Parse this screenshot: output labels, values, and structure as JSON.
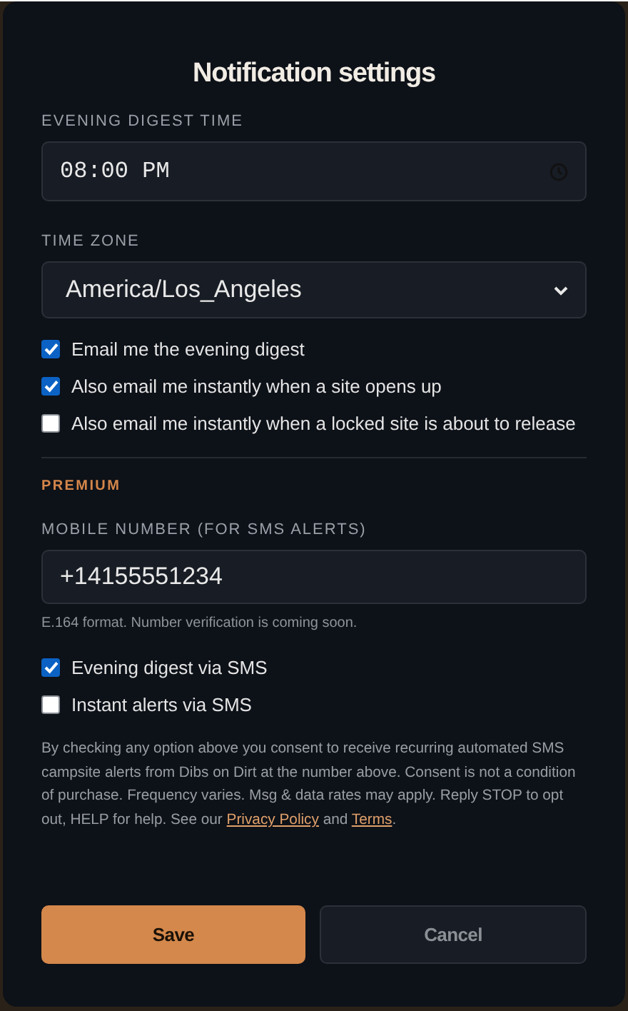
{
  "dialog": {
    "title": "Notification settings"
  },
  "time_field": {
    "label": "EVENING DIGEST TIME",
    "value": "08:00 PM"
  },
  "timezone_field": {
    "label": "TIME ZONE",
    "value": "America/Los_Angeles"
  },
  "email_options": [
    {
      "label": "Email me the evening digest",
      "checked": true
    },
    {
      "label": "Also email me instantly when a site opens up",
      "checked": true
    },
    {
      "label": "Also email me instantly when a locked site is about to release",
      "checked": false
    }
  ],
  "premium": {
    "heading": "PREMIUM",
    "phone_label": "MOBILE NUMBER (FOR SMS ALERTS)",
    "phone_value": "+14155551234",
    "helper": "E.164 format. Number verification is coming soon.",
    "sms_options": [
      {
        "label": "Evening digest via SMS",
        "checked": true
      },
      {
        "label": "Instant alerts via SMS",
        "checked": false
      }
    ],
    "consent": {
      "text": "By checking any option above you consent to receive recurring automated SMS campsite alerts from Dibs on Dirt at the number above. Consent is not a condition of purchase. Frequency varies. Msg & data rates may apply. Reply STOP to opt out, HELP for help. See our ",
      "links": [
        "Privacy Policy",
        "Terms"
      ],
      "joiner": " and ",
      "end": "."
    }
  },
  "buttons": [
    {
      "label": "Save",
      "kind": "primary"
    },
    {
      "label": "Cancel",
      "kind": "secondary"
    }
  ]
}
